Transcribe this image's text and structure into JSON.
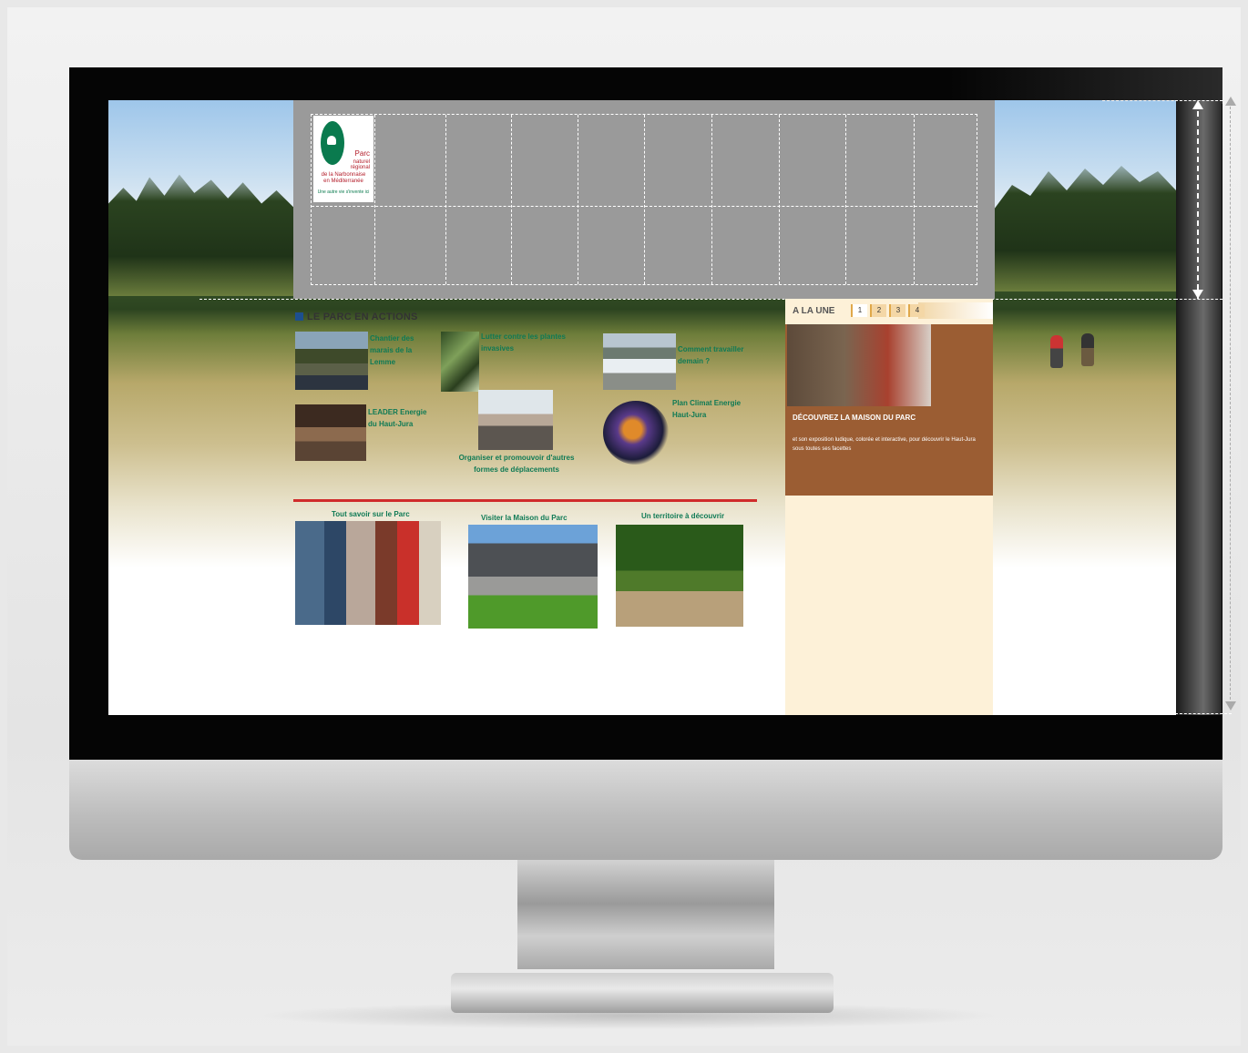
{
  "site": {
    "logo": {
      "line1": "Parc",
      "line2": "naturel",
      "line3": "régional",
      "line4": "de la Narbonnaise",
      "line5": "en Méditerranée",
      "tagline": "Une autre vie s'invente ici"
    }
  },
  "main": {
    "section_title": "LE PARC EN ACTIONS",
    "actions": [
      {
        "label": "Chantier des marais de la Lemme"
      },
      {
        "label": "Lutter contre les plantes invasives"
      },
      {
        "label": "Comment travailler demain ?"
      },
      {
        "label": "LEADER Energie du Haut-Jura"
      },
      {
        "label": "Organiser et promouvoir d'autres formes de déplacements"
      },
      {
        "label": "Plan Climat Energie Haut-Jura"
      }
    ],
    "photos": [
      {
        "caption": "Tout savoir sur le Parc"
      },
      {
        "caption": "Visiter la Maison du Parc"
      },
      {
        "caption": "Un territoire à découvrir"
      }
    ]
  },
  "sidebar": {
    "label": "A LA UNE",
    "tabs": [
      "1",
      "2",
      "3",
      "4"
    ],
    "feature": {
      "title": "DÉCOUVREZ LA MAISON DU PARC",
      "text": "et son exposition ludique, colorée et interactive, pour découvrir le Haut-Jura sous toutes ses facettes"
    }
  },
  "colors": {
    "accent_green": "#0f7a55",
    "rule_red": "#d02b2b",
    "feature_brown": "#9b5d33",
    "sidebar_bg": "#fdf1d8",
    "header_gray": "#9a9a9a"
  }
}
